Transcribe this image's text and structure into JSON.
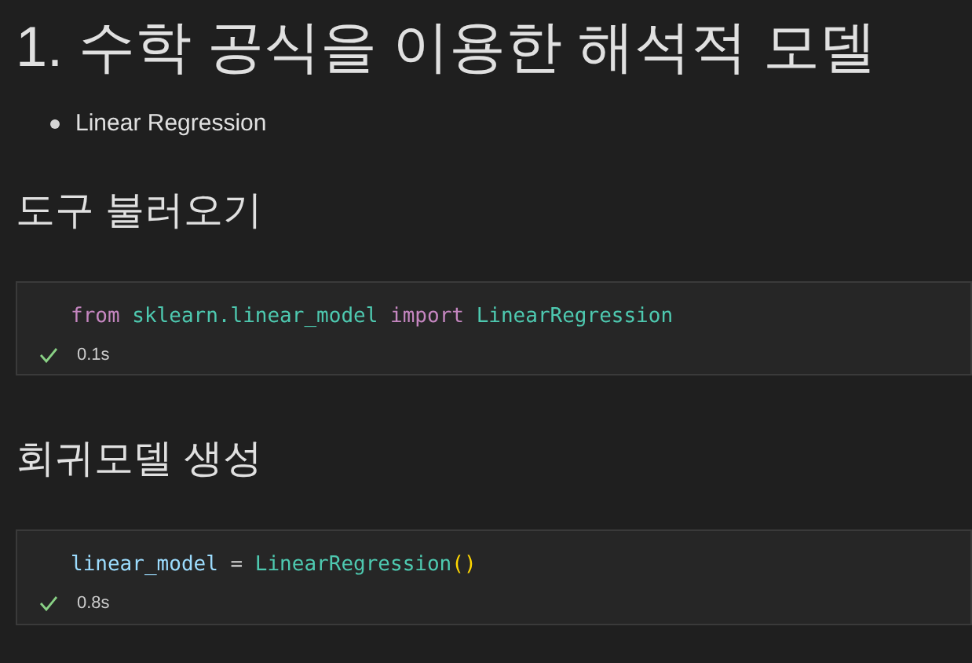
{
  "blocks": [
    {
      "kind": "h1",
      "text": "1. 수학 공식을 이용한 해석적 모델"
    },
    {
      "kind": "bullets",
      "items": [
        "Linear Regression"
      ]
    },
    {
      "kind": "h2",
      "text": "도구 불러오기"
    },
    {
      "kind": "cell",
      "tokens": [
        {
          "kind": "keyword",
          "text": "from "
        },
        {
          "kind": "module",
          "text": "sklearn.linear_model "
        },
        {
          "kind": "keyword",
          "text": "import "
        },
        {
          "kind": "class",
          "text": "LinearRegression"
        }
      ],
      "succeeded": true,
      "time": "0.1s"
    },
    {
      "kind": "h2",
      "text": "회귀모델 생성"
    },
    {
      "kind": "cell",
      "tokens": [
        {
          "kind": "variable",
          "text": "linear_model"
        },
        {
          "kind": "plain",
          "text": " = "
        },
        {
          "kind": "class",
          "text": "LinearRegression"
        },
        {
          "kind": "paren",
          "text": "()"
        }
      ],
      "succeeded": true,
      "time": "0.8s"
    }
  ]
}
